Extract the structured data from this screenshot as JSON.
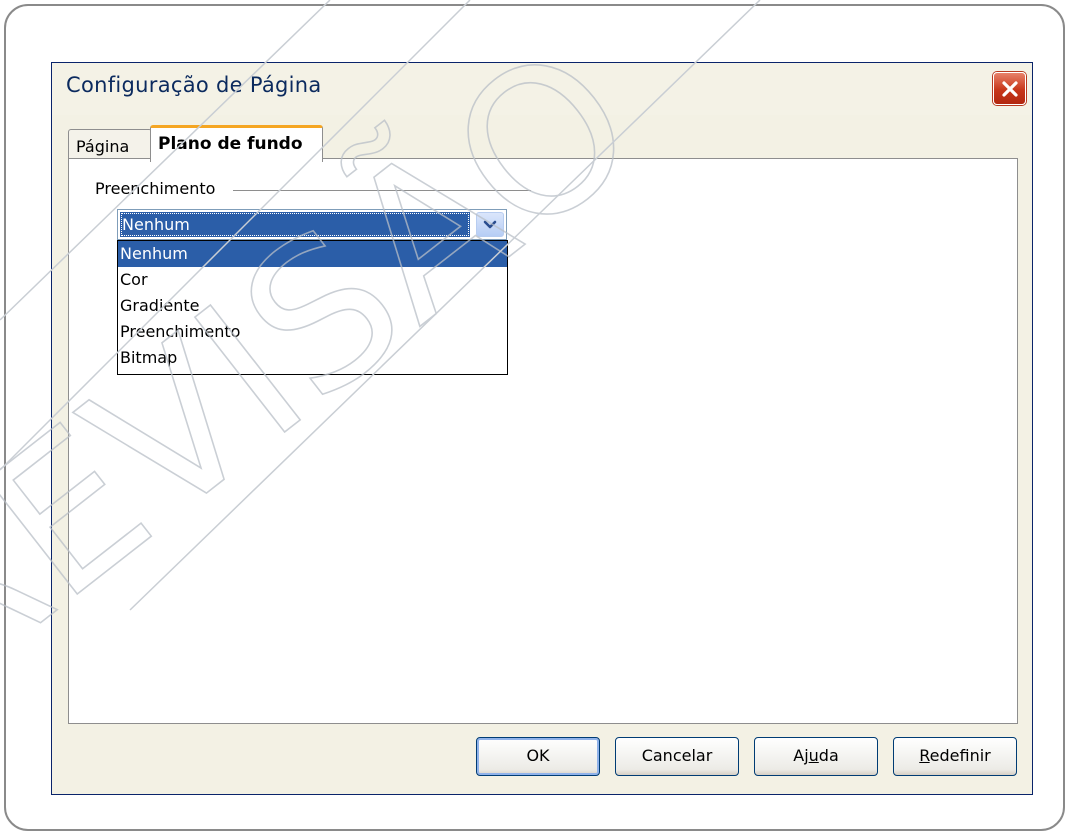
{
  "dialog": {
    "title": "Configuração de Página",
    "close_icon": "close-icon"
  },
  "tabs": [
    {
      "label": "Página",
      "active": false
    },
    {
      "label": "Plano de fundo",
      "active": true
    }
  ],
  "fill_group": {
    "label": "Preenchimento",
    "select_value": "Nenhum",
    "options": [
      "Nenhum",
      "Cor",
      "Gradiente",
      "Preenchimento",
      "Bitmap"
    ],
    "selected_index": 0
  },
  "buttons": {
    "ok": "OK",
    "cancel": "Cancelar",
    "help": "Ajuda",
    "reset": "Redefinir"
  },
  "watermark": {
    "text": "REVISÃO"
  },
  "colors": {
    "selection": "#2b5ea8",
    "tab_accent": "#f5a623",
    "close_button": "#c7361a",
    "dialog_border": "#0a246a"
  }
}
